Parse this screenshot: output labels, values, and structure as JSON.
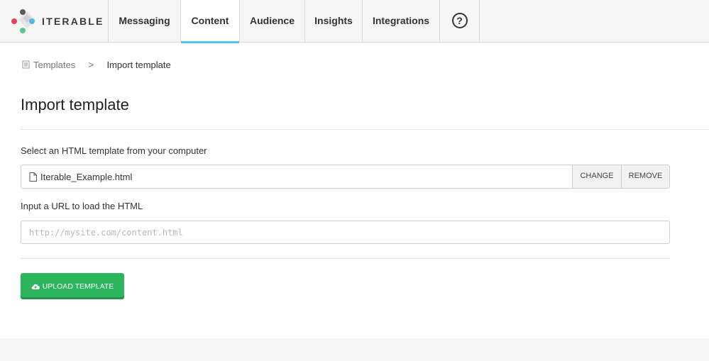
{
  "brand": {
    "name": "ITERABLE",
    "logo_icon": "iterable-logo-icon"
  },
  "nav": {
    "items": [
      {
        "label": "Messaging",
        "active": false
      },
      {
        "label": "Content",
        "active": true
      },
      {
        "label": "Audience",
        "active": false
      },
      {
        "label": "Insights",
        "active": false
      },
      {
        "label": "Integrations",
        "active": false
      }
    ],
    "help_label": "?",
    "active_color": "#59c1e8"
  },
  "breadcrumb": {
    "parent_label": "Templates",
    "parent_icon": "template-icon",
    "separator": ">",
    "current_label": "Import template"
  },
  "page": {
    "title": "Import template"
  },
  "file_select": {
    "label": "Select an HTML template from your computer",
    "file_name": "Iterable_Example.html",
    "file_icon": "document-icon",
    "change_label": "CHANGE",
    "remove_label": "REMOVE"
  },
  "url_input": {
    "label": "Input a URL to load the HTML",
    "placeholder": "http://mysite.com/content.html",
    "value": ""
  },
  "upload_button": {
    "label": "UPLOAD TEMPLATE",
    "icon": "cloud-upload-icon",
    "color": "#2db55d"
  }
}
